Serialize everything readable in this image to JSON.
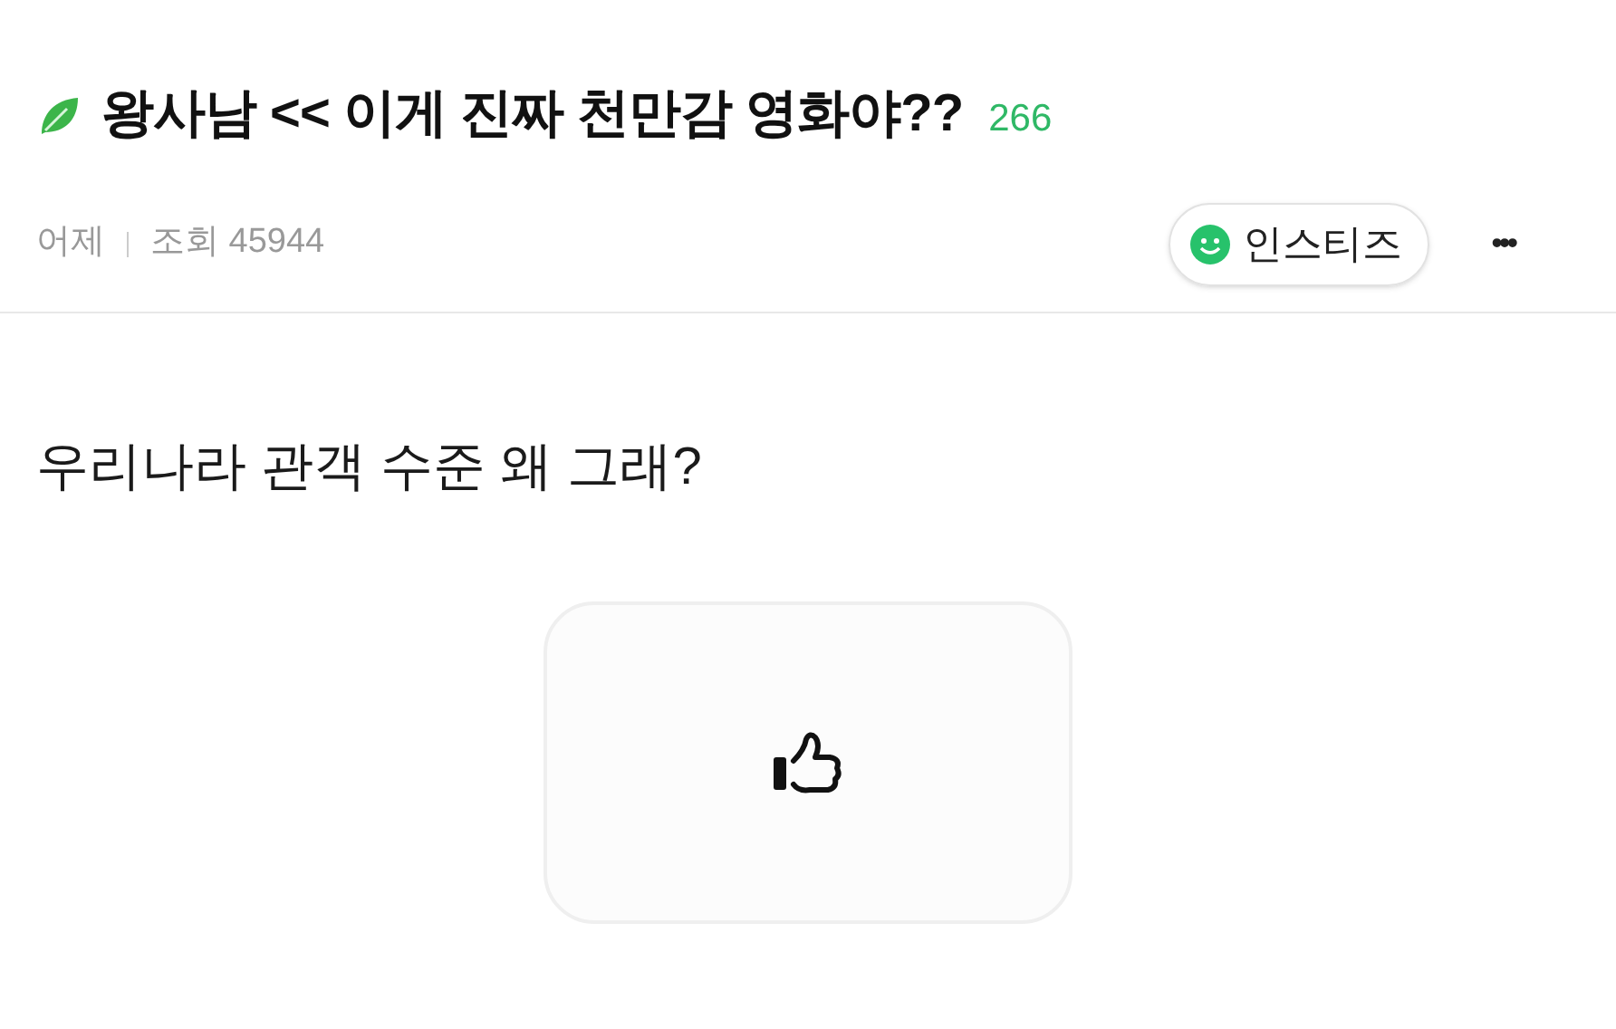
{
  "post": {
    "title": "왕사남 << 이게 진짜 천만감 영화야??",
    "comment_count": "266",
    "date": "어제",
    "views": "조회 45944",
    "board": "인스티즈",
    "more": "•••"
  },
  "body": "우리나라 관객 수준 왜 그래?"
}
